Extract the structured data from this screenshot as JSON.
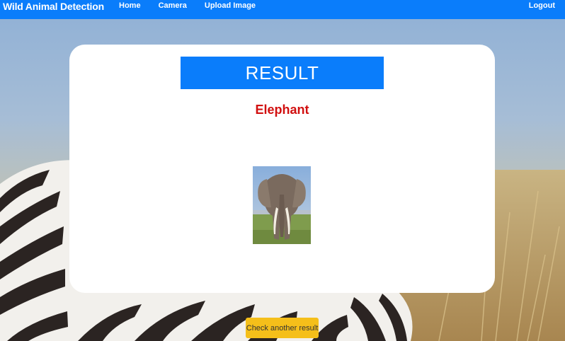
{
  "navbar": {
    "brand": "Wild Animal Detection",
    "links": [
      "Home",
      "Camera",
      "Upload Image"
    ],
    "logout": "Logout"
  },
  "result": {
    "heading": "RESULT",
    "animal": "Elephant",
    "photo_subject": "elephant"
  },
  "actions": {
    "check_another": "Check another result"
  },
  "colors": {
    "navbar": "#0a7dfb",
    "banner": "#0a7dfb",
    "animal_text": "#d10f0f",
    "button": "#f5bf1a"
  }
}
